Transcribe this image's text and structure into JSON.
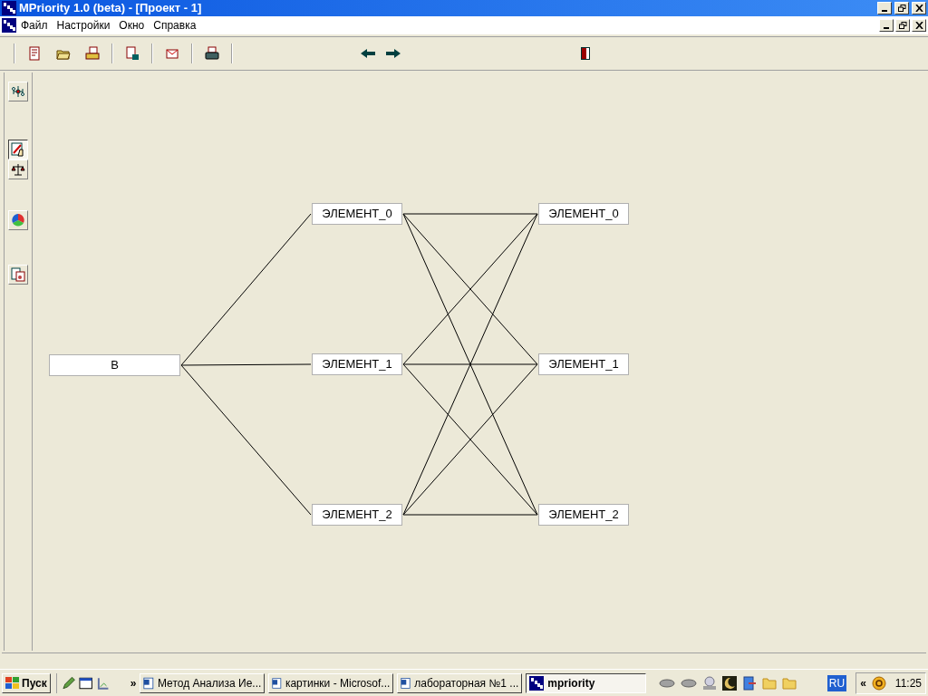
{
  "window": {
    "title": "MPriority 1.0 (beta) - [Проект - 1]"
  },
  "menu": [
    "Файл",
    "Настройки",
    "Окно",
    "Справка"
  ],
  "side_tools": [
    {
      "selected": false
    },
    {
      "selected": true
    },
    {
      "selected": false
    },
    {
      "selected": false
    },
    {
      "selected": false
    }
  ],
  "hierarchy": {
    "goal": "В",
    "levels": [
      [
        "ЭЛЕМЕНТ_0",
        "ЭЛЕМЕНТ_1",
        "ЭЛЕМЕНТ_2"
      ],
      [
        "ЭЛЕМЕНТ_0",
        "ЭЛЕМЕНТ_1",
        "ЭЛЕМЕНТ_2"
      ]
    ]
  },
  "taskbar": {
    "start": "Пуск",
    "more": "»",
    "tasks": [
      {
        "label": "Метод Анализа Ие...",
        "kind": "word",
        "selected": false
      },
      {
        "label": "картинки - Microsof...",
        "kind": "word",
        "selected": false
      },
      {
        "label": "лабораторная №1 ...",
        "kind": "word",
        "selected": false
      },
      {
        "label": "mpriority",
        "kind": "app",
        "selected": true
      }
    ],
    "language": "RU",
    "tray_expand": "«",
    "time": "11:25"
  }
}
